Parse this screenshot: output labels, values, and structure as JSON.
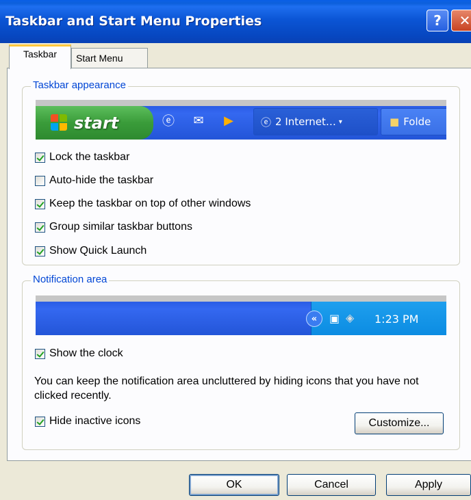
{
  "window": {
    "title": "Taskbar and Start Menu Properties",
    "help_glyph": "?",
    "close_glyph": "✕"
  },
  "tabs": [
    {
      "label": "Taskbar",
      "active": true
    },
    {
      "label": "Start Menu",
      "active": false
    }
  ],
  "taskbar_appearance": {
    "legend": "Taskbar appearance",
    "preview": {
      "start_label": "start",
      "button1": "2 Internet…",
      "button2": "Folde"
    },
    "options": [
      {
        "label": "Lock the taskbar",
        "checked": true
      },
      {
        "label": "Auto-hide the taskbar",
        "checked": false
      },
      {
        "label": "Keep the taskbar on top of other windows",
        "checked": true
      },
      {
        "label": "Group similar taskbar buttons",
        "checked": true
      },
      {
        "label": "Show Quick Launch",
        "checked": true
      }
    ]
  },
  "notification_area": {
    "legend": "Notification area",
    "preview": {
      "clock": "1:23 PM",
      "chevron": "«"
    },
    "show_clock": {
      "label": "Show the clock",
      "checked": true
    },
    "info": "You can keep the notification area uncluttered by hiding icons that you have not clicked recently.",
    "hide_inactive": {
      "label": "Hide inactive icons",
      "checked": true
    },
    "customize_label": "Customize..."
  },
  "buttons": {
    "ok": "OK",
    "cancel": "Cancel",
    "apply": "Apply"
  },
  "colors": {
    "accent": "#0046D5",
    "titlebar": "#0A55D5",
    "start_green": "#3A9C3A",
    "check": "#21A121"
  }
}
